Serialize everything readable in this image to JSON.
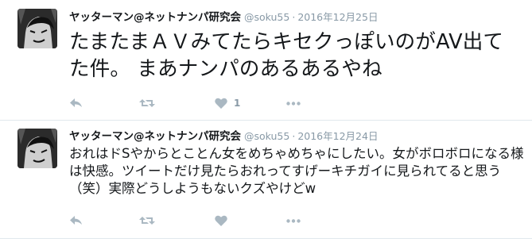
{
  "tweets": [
    {
      "name": "ヤッターマン@ネットナンパ研究会",
      "handle": "@soku55",
      "separator": "·",
      "date": "2016年12月25日",
      "text": "たまたまＡＶみてたらキセクっぽいのがAV出てた件。 まあナンパのあるあるやね",
      "like_count": "1",
      "icons": [
        "reply-icon",
        "retweet-icon",
        "like-icon",
        "more-icon"
      ]
    },
    {
      "name": "ヤッターマン@ネットナンパ研究会",
      "handle": "@soku55",
      "separator": "·",
      "date": "2016年12月24日",
      "text": "おれはドSやからとことん女をめちゃめちゃにしたい。女がボロボロになる様は快感。ツイートだけ見たらおれってすげーキチガイに見られてると思う（笑）実際どうしようもないクズやけどw",
      "like_count": "",
      "icons": [
        "reply-icon",
        "retweet-icon",
        "like-icon",
        "more-icon"
      ]
    }
  ],
  "colors": {
    "text": "#14171a",
    "meta": "#8899a6",
    "icon": "#aab8c2",
    "divider": "#e1e8ed"
  }
}
